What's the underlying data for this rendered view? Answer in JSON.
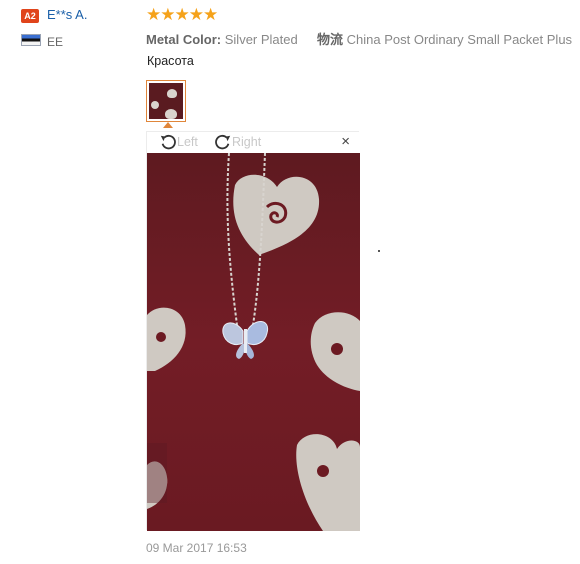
{
  "reviewer": {
    "level_badge": "A2",
    "name": "E**s A.",
    "country_code": "EE"
  },
  "review": {
    "rating": 5,
    "stars_text": "★★★★★",
    "attributes": [
      {
        "key": "Metal Color:",
        "value": "Silver Plated"
      },
      {
        "key": "物流",
        "value": "China Post Ordinary Small Packet Plus"
      }
    ],
    "text": "Красота",
    "date": "09 Mar 2017 16:53"
  },
  "viewer": {
    "rotate_left_label": "Left",
    "rotate_right_label": "Right",
    "close_label": "×"
  },
  "colors": {
    "star": "#f5a21a",
    "username": "#1a5fa8",
    "badge": "#e0441b",
    "thumb_border": "#e0863a",
    "fabric": "#6b1a22"
  }
}
